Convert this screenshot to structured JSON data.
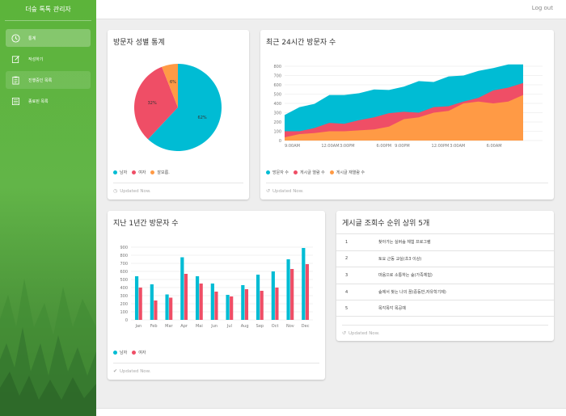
{
  "app": {
    "title": "더숲 톡톡 관리자",
    "logout": "Log out"
  },
  "sidebar": {
    "items": [
      {
        "label": "통계",
        "icon": "clock-icon"
      },
      {
        "label": "작성하기",
        "icon": "edit-icon"
      },
      {
        "label": "진행중인 목록",
        "icon": "clipboard-icon"
      },
      {
        "label": "종료된 목록",
        "icon": "list-icon"
      }
    ]
  },
  "colors": {
    "cyan": "#00bcd4",
    "red": "#ef4e66",
    "orange": "#ff9a45",
    "sidebar": "#5cb43a"
  },
  "gender_card": {
    "title": "방문자 성별 통계",
    "footer": "Updated Now.",
    "chart_data": {
      "type": "pie",
      "labels": [
        "남자",
        "여자",
        "잘 모름"
      ],
      "values": [
        62,
        32,
        6
      ],
      "slice_labels": [
        "62%",
        "32%",
        "6%"
      ],
      "legend": [
        "남자",
        "여자",
        "잘모름."
      ]
    }
  },
  "hourly_card": {
    "title": "최근 24시간 방문자 수",
    "footer": "Updated Now.",
    "chart_data": {
      "type": "area",
      "x": [
        "9:00AM",
        "",
        "12:00AM",
        "3:00PM",
        "",
        "6:00PM",
        "9:00PM",
        "",
        "12:00PM",
        "3:00AM",
        "",
        "6:00AM",
        "",
        ""
      ],
      "yticks": [
        0,
        100,
        200,
        300,
        400,
        500,
        600,
        700,
        800
      ],
      "ylim": [
        0,
        800
      ],
      "series": [
        {
          "name": "방문자 수",
          "values": [
            275,
            360,
            395,
            490,
            490,
            510,
            550,
            545,
            580,
            640,
            630,
            690,
            700,
            750,
            780,
            820,
            820
          ]
        },
        {
          "name": "게시글 열람 수",
          "values": [
            100,
            100,
            135,
            190,
            180,
            220,
            250,
            295,
            310,
            300,
            360,
            370,
            420,
            460,
            540,
            570,
            620
          ]
        },
        {
          "name": "게시글 재열람 수",
          "values": [
            35,
            70,
            80,
            100,
            100,
            110,
            120,
            150,
            230,
            250,
            300,
            320,
            400,
            420,
            400,
            420,
            490
          ]
        }
      ],
      "legend": [
        "방문자 수",
        "게시글 열람 수",
        "게시글 재열람 수"
      ]
    }
  },
  "yearly_card": {
    "title": "지난 1년간 방문자 수",
    "footer": "Updated Now.",
    "chart_data": {
      "type": "bar",
      "categories": [
        "Jan",
        "Feb",
        "Mar",
        "Apr",
        "Mai",
        "Jun",
        "Jul",
        "Aug",
        "Sep",
        "Oct",
        "Nov",
        "Dec"
      ],
      "yticks": [
        0,
        100,
        200,
        300,
        400,
        500,
        600,
        700,
        800,
        900
      ],
      "ylim": [
        0,
        900
      ],
      "series": [
        {
          "name": "남자",
          "values": [
            540,
            440,
            315,
            775,
            540,
            450,
            310,
            430,
            560,
            600,
            750,
            890
          ]
        },
        {
          "name": "여자",
          "values": [
            400,
            240,
            275,
            570,
            450,
            350,
            290,
            380,
            360,
            400,
            630,
            690
          ]
        }
      ],
      "legend": [
        "남자",
        "여자"
      ]
    }
  },
  "top5_card": {
    "title": "게시글 조회수 순위 상위 5개",
    "footer": "Updated Now.",
    "rows": [
      {
        "rank": "1",
        "title": "찾아가는 실버숲 체험 프로그램"
      },
      {
        "rank": "2",
        "title": "토요 근동 교실(초3 이상)"
      },
      {
        "rank": "3",
        "title": "마음으로 소통하는 숲(가족체험)"
      },
      {
        "rank": "4",
        "title": "숲에서 찾는 나의 꿈(중등반,자유학기제)"
      },
      {
        "rank": "5",
        "title": "목각목각 목공예"
      }
    ]
  }
}
